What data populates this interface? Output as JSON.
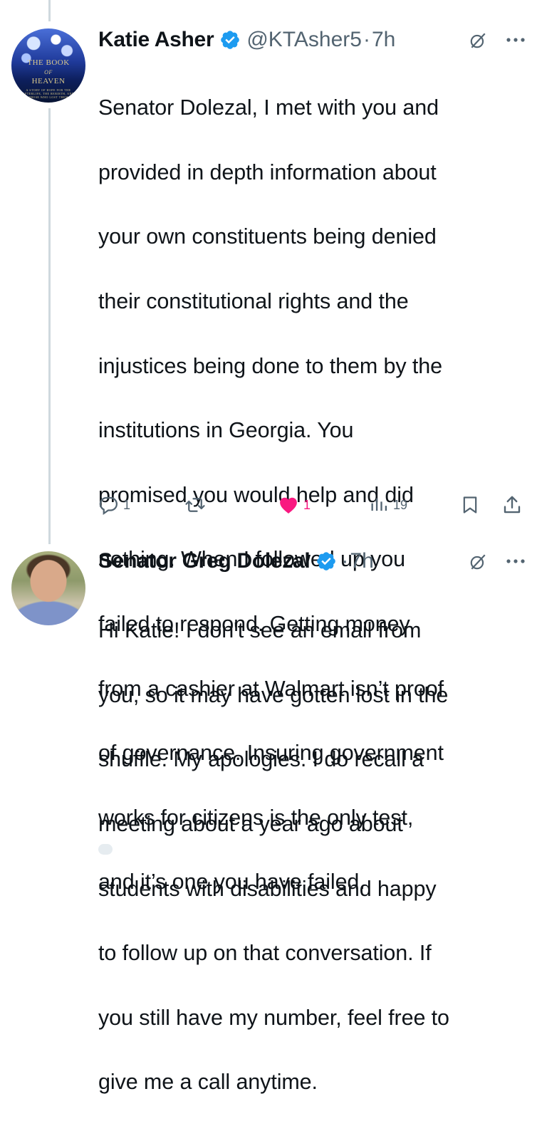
{
  "tweets": [
    {
      "avatar": "The Book of Heaven book cover",
      "avatar_text": {
        "line1": "THE BOOK",
        "line2": "OF",
        "line3": "HEAVEN",
        "fine": "A STORY OF HOPE FOR THE AFTERLIFE, THE REBIRTH, AND THOSE WHO LOST THEM"
      },
      "name": "Katie Asher",
      "verified": true,
      "handle": "@KTAsher5",
      "separator": "·",
      "time": "7h",
      "text": "Senator Dolezal, I met with you and provided in depth information about your own constituents being denied their constitutional rights and the injustices being done to them by the institutions in Georgia. You promised you would help and did nothing. When I followed up you failed to respond. Getting money from a cashier at Walmart isn’t proof of governance. Insuring government works for citizens is the only test, and it’s one you have failed.",
      "lines": [
        "Senator Dolezal, I met with you and",
        "provided in depth information about",
        "your own constituents being denied",
        "their constitutional rights and the",
        "injustices being done to them by the",
        "institutions in Georgia. You",
        "promised you would help and did",
        "nothing. When I followed up you",
        "failed to respond. Getting money",
        "from a cashier at Walmart isn’t proof",
        "of governance. Insuring government",
        "works for citizens is the only test,",
        "and it’s one you have failed."
      ],
      "actions": {
        "reply_count": "1",
        "retweet_count": "",
        "like_count": "1",
        "liked": true,
        "views_count": "19"
      }
    },
    {
      "avatar": "Senator Greg Dolezal profile photo",
      "name": "Senator Greg Dolezal",
      "verified": true,
      "handle": "",
      "separator": "·",
      "time": "7h",
      "lines": [
        "Hi Katie! I don't see an email from",
        "you, so it may have gotten lost in the",
        "shuffle. My apologies.  I do recall a",
        "meeting about a year ago about",
        "students with disabilities and happy",
        "to follow up on that conversation. If",
        "you still have my number, feel free to",
        "give me a call anytime."
      ]
    }
  ],
  "colors": {
    "text": "#0f1419",
    "secondary": "#536471",
    "verified": "#1d9bf0",
    "like": "#f91880",
    "thread_line": "#cfd9de"
  },
  "icons": [
    "verified-badge-icon",
    "grok-icon",
    "more-icon",
    "reply-icon",
    "retweet-icon",
    "like-icon",
    "views-icon",
    "bookmark-icon",
    "share-icon"
  ]
}
